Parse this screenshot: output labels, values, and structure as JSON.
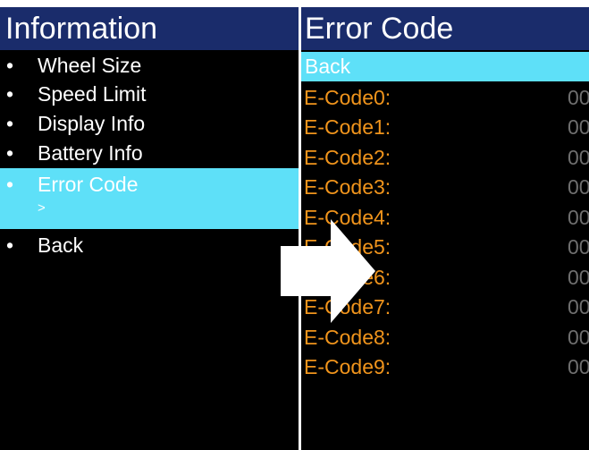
{
  "info_screen": {
    "title": "Information",
    "bullet": "•",
    "items": [
      {
        "label": "Wheel Size"
      },
      {
        "label": "Speed Limit"
      },
      {
        "label": "Display Info"
      },
      {
        "label": "Battery Info"
      }
    ],
    "selected": {
      "label": "Error Code",
      "sub_indicator": ">"
    },
    "back": {
      "label": "Back"
    }
  },
  "error_screen": {
    "title": "Error Code",
    "back_label": "Back",
    "codes": [
      {
        "label": "E-Code0:",
        "value": "00"
      },
      {
        "label": "E-Code1:",
        "value": "00"
      },
      {
        "label": "E-Code2:",
        "value": "00"
      },
      {
        "label": "E-Code3:",
        "value": "00"
      },
      {
        "label": "E-Code4:",
        "value": "00"
      },
      {
        "label": "E-Code5:",
        "value": "00"
      },
      {
        "label": "E-Code6:",
        "value": "00"
      },
      {
        "label": "E-Code7:",
        "value": "00"
      },
      {
        "label": "E-Code8:",
        "value": "00"
      },
      {
        "label": "E-Code9:",
        "value": "00"
      }
    ]
  },
  "colors": {
    "title_bar": "#1a2c6b",
    "highlight": "#5ee0f8",
    "code_label": "#f0941c",
    "code_value": "#6f6f6f",
    "screen_bg": "#000000"
  },
  "icons": {
    "transition_arrow": "right-arrow-icon"
  }
}
